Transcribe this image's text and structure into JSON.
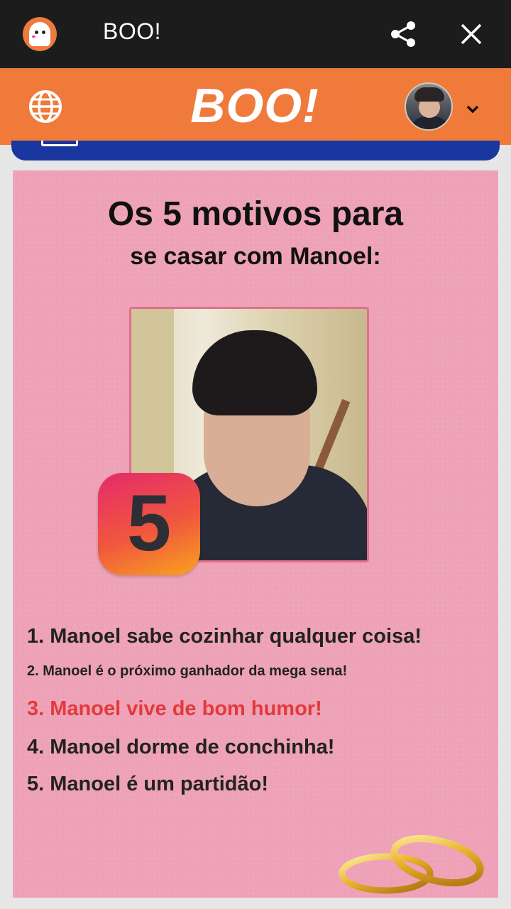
{
  "appbar": {
    "title": "BOO!"
  },
  "header": {
    "logo": "BOO!"
  },
  "post": {
    "title_line1": "Os 5 motivos para",
    "title_line2": "se casar com Manoel:",
    "badge_number": "5",
    "reasons": [
      "1. Manoel sabe cozinhar qualquer coisa!",
      "2. Manoel é o próximo ganhador da mega sena!",
      "3. Manoel vive de bom humor!",
      "4. Manoel dorme de conchinha!",
      "5. Manoel é um partidão!"
    ]
  },
  "colors": {
    "appbar": "#1c1c1c",
    "header": "#f07a3a",
    "card": "#eea2b8",
    "highlight_reason": "#e23a3a",
    "strip": "#1a37a0"
  },
  "icons": [
    "app-icon",
    "share-icon",
    "close-icon",
    "globe-icon",
    "avatar",
    "chevron-down-icon",
    "rings-icon"
  ]
}
